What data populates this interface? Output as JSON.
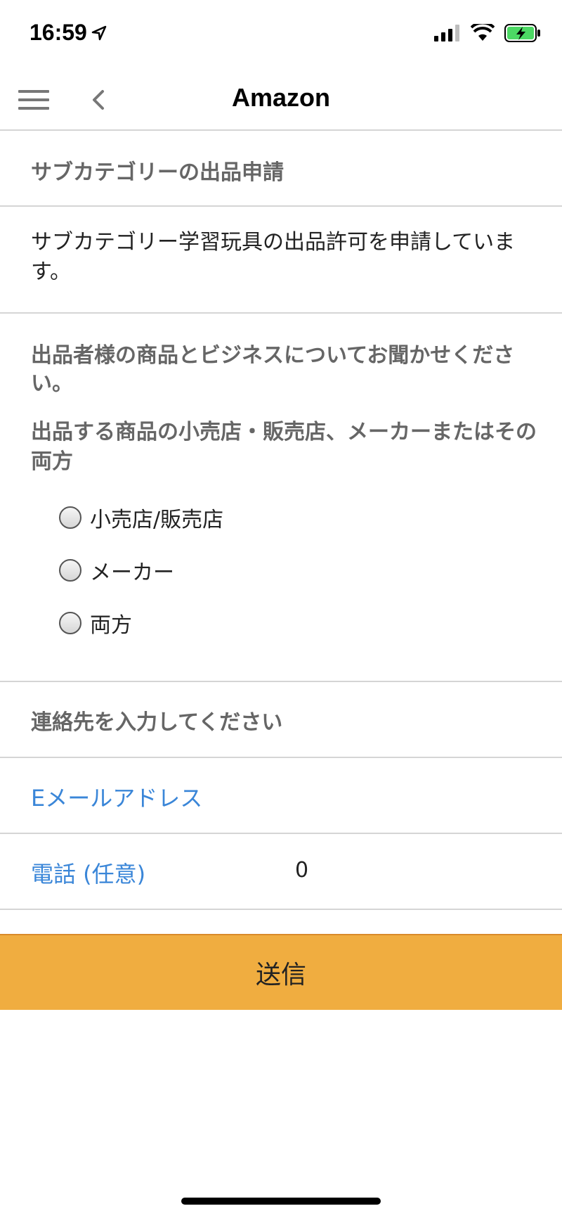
{
  "status_bar": {
    "time": "16:59"
  },
  "nav": {
    "title": "Amazon"
  },
  "page": {
    "section_title": "サブカテゴリーの出品申請",
    "description": "サブカテゴリー学習玩具の出品許可を申請しています。"
  },
  "question": {
    "intro": "出品者様の商品とビジネスについてお聞かせください。",
    "label": "出品する商品の小売店・販売店、メーカーまたはその両方",
    "options": [
      {
        "label": "小売店/販売店",
        "selected": false
      },
      {
        "label": "メーカー",
        "selected": false
      },
      {
        "label": "両方",
        "selected": false
      }
    ]
  },
  "contact": {
    "heading": "連絡先を入力してください",
    "email_label": "Eメールアドレス",
    "email_value": "",
    "phone_label": "電話 (任意)",
    "phone_value": "0"
  },
  "submit_label": "送信",
  "colors": {
    "accent_link": "#3a86d8",
    "submit_bg": "#f0ad40",
    "heading_gray": "#666666",
    "battery_green": "#4cd964"
  }
}
